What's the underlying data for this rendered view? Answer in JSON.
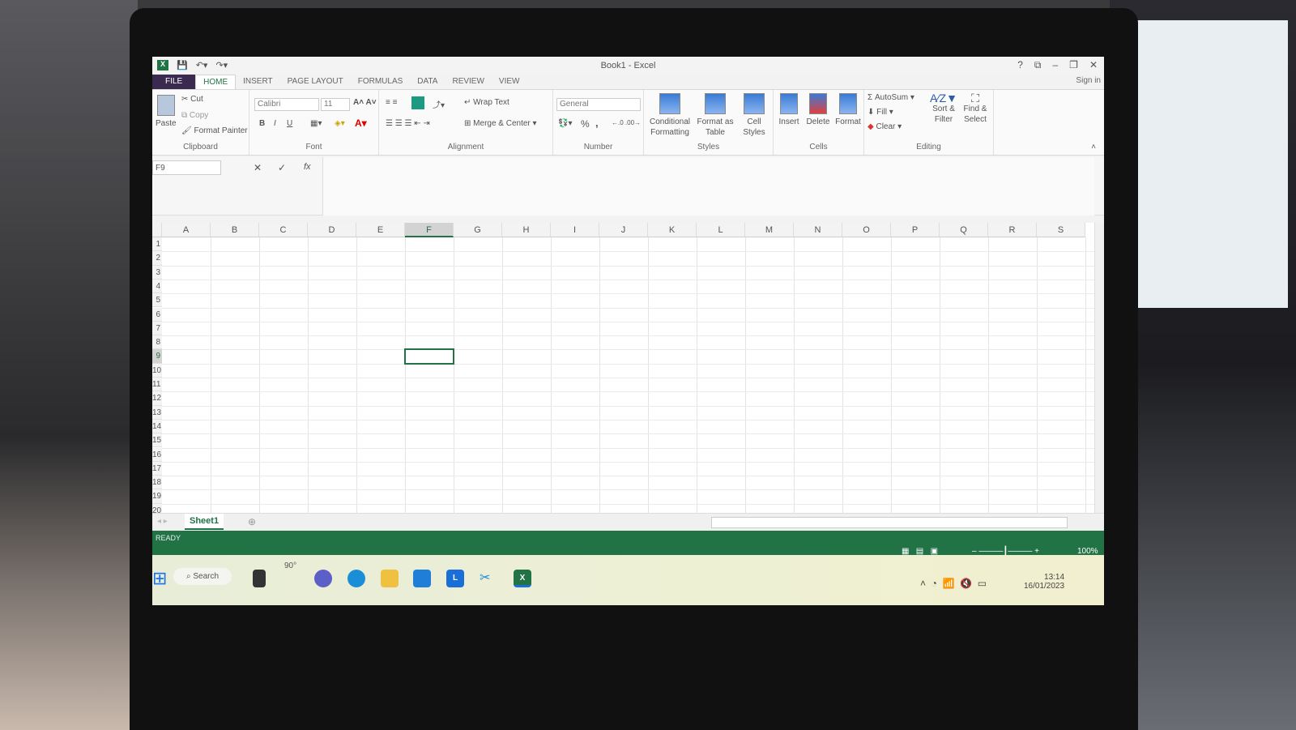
{
  "window": {
    "title": "Book1 - Excel",
    "controls": [
      "?",
      "⧉",
      "–",
      "❐",
      "✕"
    ],
    "sign_in": "Sign in"
  },
  "tabs": [
    {
      "label": "FILE"
    },
    {
      "label": "HOME",
      "active": true
    },
    {
      "label": "INSERT"
    },
    {
      "label": "PAGE LAYOUT"
    },
    {
      "label": "FORMULAS"
    },
    {
      "label": "DATA"
    },
    {
      "label": "REVIEW"
    },
    {
      "label": "VIEW"
    }
  ],
  "ribbon": {
    "clipboard": {
      "label": "Clipboard",
      "paste": "Paste",
      "cut": "Cut",
      "copy": "Copy",
      "format_painter": "Format Painter"
    },
    "font": {
      "label": "Font",
      "name": "Calibri",
      "size": "11",
      "bold": "B",
      "italic": "I",
      "underline": "U"
    },
    "alignment": {
      "label": "Alignment",
      "wrap": "Wrap Text",
      "merge": "Merge & Center"
    },
    "number": {
      "label": "Number",
      "format": "General",
      "percent": "%",
      "comma": ","
    },
    "styles": {
      "label": "Styles",
      "conditional": "Conditional Formatting",
      "table": "Format as Table",
      "cell": "Cell Styles"
    },
    "cells": {
      "label": "Cells",
      "insert": "Insert",
      "delete": "Delete",
      "format": "Format"
    },
    "editing": {
      "label": "Editing",
      "autosum": "AutoSum",
      "fill": "Fill",
      "clear": "Clear",
      "sort": "Sort & Filter",
      "find": "Find & Select"
    }
  },
  "formula_bar": {
    "name_box": "F9",
    "fx": "fx",
    "value": ""
  },
  "grid": {
    "columns": [
      "A",
      "B",
      "C",
      "D",
      "E",
      "F",
      "G",
      "H",
      "I",
      "J",
      "K",
      "L",
      "M",
      "N",
      "O",
      "P",
      "Q",
      "R",
      "S"
    ],
    "rows": 20,
    "active_cell": "F9"
  },
  "sheets": [
    {
      "label": "Sheet1",
      "active": true
    }
  ],
  "status": {
    "text": "READY",
    "zoom": "100%"
  },
  "taskbar": {
    "search": "Search",
    "weather": "90°",
    "time": "13:14",
    "date": "16/01/2023"
  },
  "colors": {
    "excel_green": "#217346",
    "file_tab": "#3b2a4f"
  }
}
